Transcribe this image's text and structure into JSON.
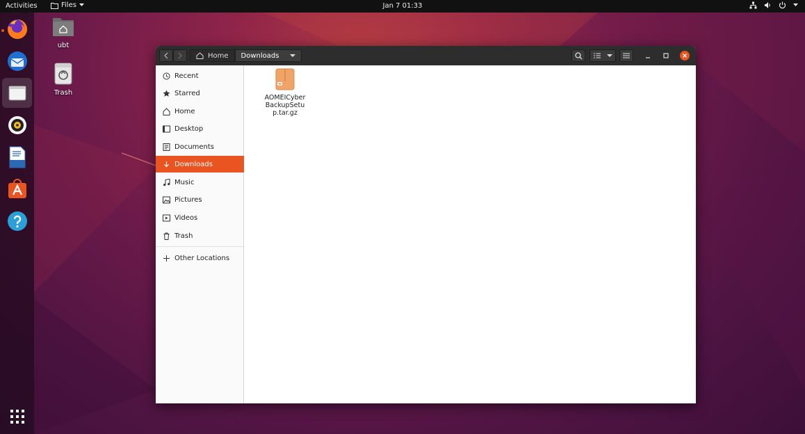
{
  "topbar": {
    "activities": "Activities",
    "app_menu": "Files",
    "clock": "Jan 7  01:33"
  },
  "dock": {
    "items": [
      {
        "name": "firefox",
        "active": false
      },
      {
        "name": "thunderbird",
        "active": false
      },
      {
        "name": "files",
        "active": true
      },
      {
        "name": "rhythmbox",
        "active": false
      },
      {
        "name": "libreoffice-writer",
        "active": false
      },
      {
        "name": "ubuntu-software",
        "active": false
      },
      {
        "name": "help",
        "active": false
      }
    ]
  },
  "desktop": {
    "icons": [
      {
        "label": "ubt"
      },
      {
        "label": "Trash"
      }
    ]
  },
  "window": {
    "path": {
      "home": "Home",
      "current": "Downloads"
    },
    "sidebar": {
      "items": [
        {
          "label": "Recent",
          "icon": "clock-icon"
        },
        {
          "label": "Starred",
          "icon": "star-icon"
        },
        {
          "label": "Home",
          "icon": "home-icon"
        },
        {
          "label": "Desktop",
          "icon": "desktop-icon"
        },
        {
          "label": "Documents",
          "icon": "document-icon"
        },
        {
          "label": "Downloads",
          "icon": "download-icon",
          "active": true
        },
        {
          "label": "Music",
          "icon": "music-icon"
        },
        {
          "label": "Pictures",
          "icon": "picture-icon"
        },
        {
          "label": "Videos",
          "icon": "video-icon"
        },
        {
          "label": "Trash",
          "icon": "trash-icon"
        }
      ],
      "other": {
        "label": "Other Locations",
        "icon": "plus-icon"
      }
    },
    "files": [
      {
        "name": "AOMEICyberBackupSetup.tar.gz",
        "icon": "archive-icon"
      }
    ]
  },
  "colors": {
    "accent": "#e95420",
    "headerbar": "#2d2d2d",
    "topbar": "#111111"
  }
}
